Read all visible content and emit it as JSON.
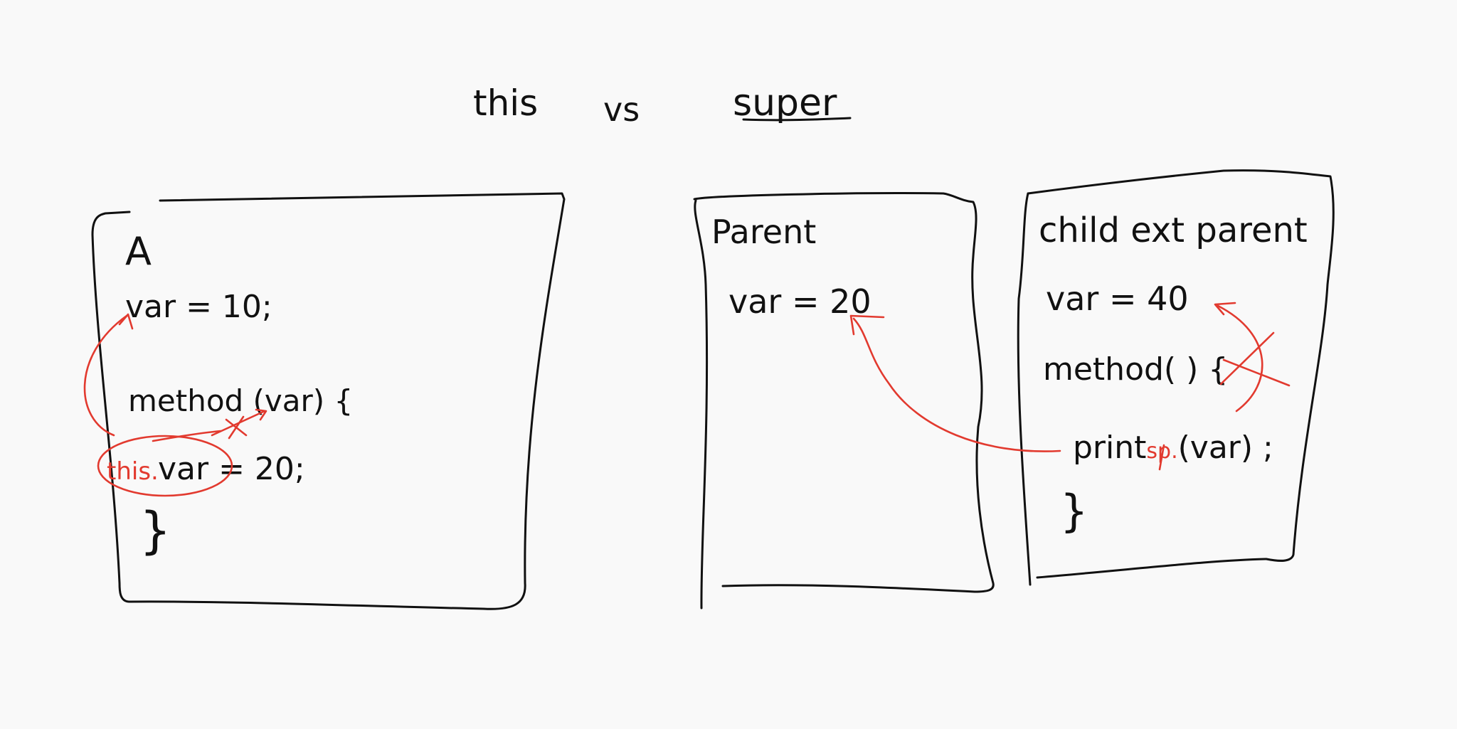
{
  "title": {
    "left": "this",
    "middle": "vs",
    "right": "super"
  },
  "box_a": {
    "name": "A",
    "line1": "var = 10;",
    "line2": "method (var) {",
    "line3_prefix": "this.",
    "line3": "var = 20;",
    "line4": "}"
  },
  "box_parent": {
    "name": "Parent",
    "line1": "var = 20"
  },
  "box_child": {
    "name": "child ext parent",
    "line1": "var = 40",
    "line2": "method( ) {",
    "line3_pre": "print",
    "line3_red": "sp.",
    "line3_post": "(var) ;",
    "line4": "}"
  },
  "colors": {
    "ink": "#111111",
    "annotation": "#e23a2f",
    "background": "#f9f9f9"
  }
}
